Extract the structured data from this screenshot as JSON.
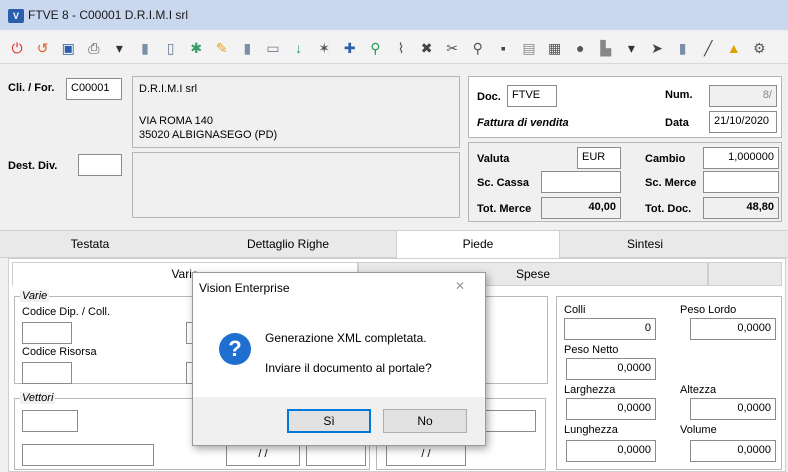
{
  "window": {
    "title": "FTVE 8 - C00001 D.R.I.M.I srl",
    "app_icon": "V"
  },
  "toolbar": {
    "icons": [
      {
        "name": "power-icon",
        "glyph": "⏻",
        "color": "#d22"
      },
      {
        "name": "refresh-icon",
        "glyph": "↺",
        "color": "#e05a1e"
      },
      {
        "name": "save-icon",
        "glyph": "▣",
        "color": "#2b5fae"
      },
      {
        "name": "print-icon",
        "glyph": "⎙",
        "color": "#555"
      },
      {
        "name": "dropdown-icon",
        "glyph": "▾",
        "color": "#333"
      },
      {
        "name": "doc-icon",
        "glyph": "▮",
        "color": "#7a8fa8"
      },
      {
        "name": "preview-icon",
        "glyph": "▯",
        "color": "#6b7c95"
      },
      {
        "name": "settings-icon",
        "glyph": "✱",
        "color": "#3a9a6a"
      },
      {
        "name": "edit-icon",
        "glyph": "✎",
        "color": "#e6a21e"
      },
      {
        "name": "list-icon",
        "glyph": "▮",
        "color": "#7a8fa8"
      },
      {
        "name": "copy-icon",
        "glyph": "▭",
        "color": "#6b7c95"
      },
      {
        "name": "download-icon",
        "glyph": "↓",
        "color": "#2b9a5a"
      },
      {
        "name": "star-icon",
        "glyph": "✶",
        "color": "#555"
      },
      {
        "name": "puzzle-icon",
        "glyph": "✚",
        "color": "#2b5fae"
      },
      {
        "name": "link-icon",
        "glyph": "⚲",
        "color": "#2b9a5a"
      },
      {
        "name": "clip-icon",
        "glyph": "⌇",
        "color": "#555"
      },
      {
        "name": "delete-icon",
        "glyph": "✖",
        "color": "#444"
      },
      {
        "name": "cut-icon",
        "glyph": "✂",
        "color": "#555"
      },
      {
        "name": "search-icon",
        "glyph": "⚲",
        "color": "#555"
      },
      {
        "name": "truck-icon",
        "glyph": "▪",
        "color": "#444"
      },
      {
        "name": "notes-icon",
        "glyph": "▤",
        "color": "#888"
      },
      {
        "name": "report-icon",
        "glyph": "▦",
        "color": "#555"
      },
      {
        "name": "circle-icon",
        "glyph": "●",
        "color": "#555"
      },
      {
        "name": "stack-icon",
        "glyph": "▙",
        "color": "#888"
      },
      {
        "name": "dropdown2-icon",
        "glyph": "▾",
        "color": "#333"
      },
      {
        "name": "arrow-right-icon",
        "glyph": "➤",
        "color": "#444"
      },
      {
        "name": "book-icon",
        "glyph": "▮",
        "color": "#7a8fa8"
      },
      {
        "name": "pen-icon",
        "glyph": "╱",
        "color": "#444"
      },
      {
        "name": "warning-icon",
        "glyph": "▲",
        "color": "#e0a000"
      },
      {
        "name": "gear-icon",
        "glyph": "⚙",
        "color": "#555"
      }
    ]
  },
  "header": {
    "cli_label": "Cli. / For.",
    "cli_code": "C00001",
    "company_name": "D.R.I.M.I srl",
    "address_line1": "VIA ROMA 140",
    "address_line2": "35020 ALBIGNASEGO (PD)",
    "dest_label": "Dest. Div.",
    "doc_label": "Doc.",
    "doc_value": "FTVE",
    "doc_description": "Fattura di vendita",
    "num_label": "Num.",
    "num_value": "8/",
    "data_label": "Data",
    "data_value": "21/10/2020",
    "valuta_label": "Valuta",
    "valuta_value": "EUR",
    "cambio_label": "Cambio",
    "cambio_value": "1,000000",
    "sc_cassa_label": "Sc. Cassa",
    "sc_merce_label": "Sc. Merce",
    "tot_merce_label": "Tot. Merce",
    "tot_merce_value": "40,00",
    "tot_doc_label": "Tot. Doc.",
    "tot_doc_value": "48,80"
  },
  "tabs": [
    {
      "label": "Testata"
    },
    {
      "label": "Dettaglio Righe"
    },
    {
      "label": "Piede"
    },
    {
      "label": "Sintesi"
    }
  ],
  "subtabs": [
    {
      "label": "Varie"
    },
    {
      "label": "Spese"
    }
  ],
  "varie": {
    "group_label": "Varie",
    "codice_dip_label": "Codice Dip. / Coll.",
    "codice_risorsa_label": "Codice Risorsa",
    "vettori_label": "Vettori",
    "date_placeholder_1": "/ /",
    "date_placeholder_2": "/ /"
  },
  "colli": {
    "colli_label": "Colli",
    "colli_value": "0",
    "peso_lordo_label": "Peso Lordo",
    "peso_lordo_value": "0,0000",
    "peso_netto_label": "Peso Netto",
    "peso_netto_value": "0,0000",
    "larghezza_label": "Larghezza",
    "larghezza_value": "0,0000",
    "altezza_label": "Altezza",
    "altezza_value": "0,0000",
    "lunghezza_label": "Lunghezza",
    "lunghezza_value": "0,0000",
    "volume_label": "Volume",
    "volume_value": "0,0000"
  },
  "dialog": {
    "title": "Vision Enterprise",
    "close": "✕",
    "message1": "Generazione XML completata.",
    "message2": "Inviare il documento al portale?",
    "yes_label": "Sì",
    "no_label": "No",
    "icon": "?"
  }
}
